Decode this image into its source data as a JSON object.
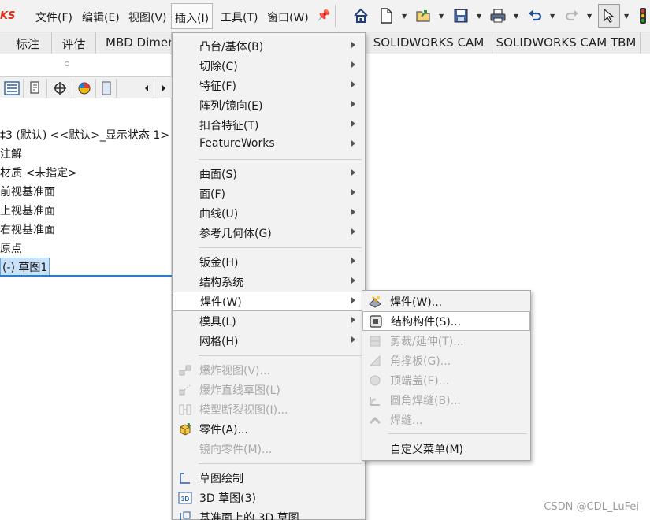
{
  "app": {
    "logo_text": "KS"
  },
  "menubar": {
    "items": [
      {
        "label": "文件(F)"
      },
      {
        "label": "编辑(E)"
      },
      {
        "label": "视图(V)"
      },
      {
        "label": "插入(I)"
      },
      {
        "label": "工具(T)"
      },
      {
        "label": "窗口(W)"
      }
    ]
  },
  "toolbar": {
    "icons": [
      "home-icon",
      "new-file-icon",
      "open-file-icon",
      "save-icon",
      "print-icon",
      "undo-icon",
      "redo-icon",
      "select-pointer-icon",
      "traffic-light-icon"
    ]
  },
  "tabs": [
    {
      "label": "标注"
    },
    {
      "label": "评估"
    },
    {
      "label": "MBD Dimen"
    },
    {
      "label": "SOLIDWORKS CAM"
    },
    {
      "label": "SOLIDWORKS CAM TBM"
    }
  ],
  "tree": {
    "root": "‡3 (默认) <<默认>_显示状态 1>",
    "items": [
      {
        "label": "注解"
      },
      {
        "label": "材质 <未指定>"
      },
      {
        "label": "前视基准面"
      },
      {
        "label": "上视基准面"
      },
      {
        "label": "右视基准面"
      },
      {
        "label": "原点"
      },
      {
        "label": "(-) 草图1"
      }
    ]
  },
  "insert_menu": {
    "items": [
      {
        "label": "凸台/基体(B)"
      },
      {
        "label": "切除(C)"
      },
      {
        "label": "特征(F)"
      },
      {
        "label": "阵列/镜向(E)"
      },
      {
        "label": "扣合特征(T)"
      },
      {
        "label": "FeatureWorks"
      },
      {
        "label": "曲面(S)"
      },
      {
        "label": "面(F)"
      },
      {
        "label": "曲线(U)"
      },
      {
        "label": "参考几何体(G)"
      },
      {
        "label": "钣金(H)"
      },
      {
        "label": "结构系统"
      },
      {
        "label": "焊件(W)"
      },
      {
        "label": "模具(L)"
      },
      {
        "label": "网格(H)"
      },
      {
        "label": "爆炸视图(V)..."
      },
      {
        "label": "爆炸直线草图(L)"
      },
      {
        "label": "模型断裂视图(I)..."
      },
      {
        "label": "零件(A)..."
      },
      {
        "label": "镜向零件(M)..."
      },
      {
        "label": "草图绘制"
      },
      {
        "label": "3D 草图(3)"
      },
      {
        "label": "基准面上的 3D 草图"
      }
    ]
  },
  "weldment_menu": {
    "items": [
      {
        "label": "焊件(W)..."
      },
      {
        "label": "结构构件(S)..."
      },
      {
        "label": "剪裁/延伸(T)..."
      },
      {
        "label": "角撑板(G)..."
      },
      {
        "label": "顶端盖(E)..."
      },
      {
        "label": "圆角焊缝(B)..."
      },
      {
        "label": "焊缝..."
      },
      {
        "label": "自定义菜单(M)"
      }
    ]
  },
  "watermark": "CSDN @CDL_LuFei",
  "colors": {
    "accent": "#2e7cc4",
    "logo": "#d9301e",
    "disabled_text": "#a8a8a8"
  }
}
